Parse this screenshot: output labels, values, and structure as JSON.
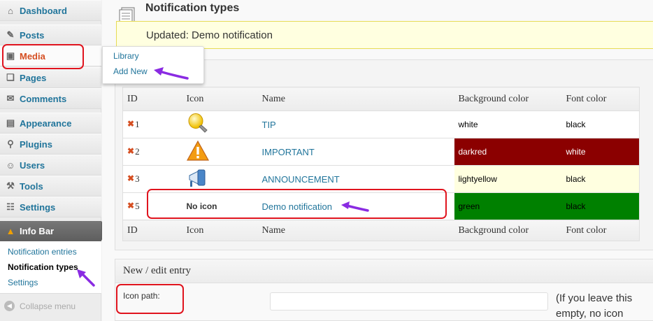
{
  "sidebar": {
    "items": [
      {
        "label": "Dashboard",
        "icon": "dashboard-icon",
        "glyph": "⌂"
      },
      {
        "label": "Posts",
        "icon": "pushpin-icon",
        "glyph": "✎"
      },
      {
        "label": "Media",
        "icon": "media-icon",
        "glyph": "▣"
      },
      {
        "label": "Pages",
        "icon": "pages-icon",
        "glyph": "❏"
      },
      {
        "label": "Comments",
        "icon": "comments-icon",
        "glyph": "✉"
      },
      {
        "label": "Appearance",
        "icon": "appearance-icon",
        "glyph": "▤"
      },
      {
        "label": "Plugins",
        "icon": "plugins-icon",
        "glyph": "⚲"
      },
      {
        "label": "Users",
        "icon": "users-icon",
        "glyph": "☺"
      },
      {
        "label": "Tools",
        "icon": "tools-icon",
        "glyph": "⚒"
      },
      {
        "label": "Settings",
        "icon": "settings-icon",
        "glyph": "☷"
      }
    ],
    "info_bar": {
      "label": "Info Bar",
      "icon": "warning-icon",
      "glyph": "▲"
    },
    "submenu": [
      "Notification entries",
      "Notification types",
      "Settings"
    ],
    "collapse_label": "Collapse menu"
  },
  "flyout": {
    "items": [
      "Library",
      "Add New"
    ]
  },
  "main": {
    "title": "Notification types",
    "notice": "Updated: Demo notification",
    "table": {
      "columns": [
        "ID",
        "Icon",
        "Name",
        "Background color",
        "Font color"
      ],
      "rows": [
        {
          "id": "1",
          "icon": "lightbulb-icon",
          "name": "TIP",
          "bg": "white",
          "font": "black",
          "bg_hex": "#ffffff",
          "fg_hex": "#000000"
        },
        {
          "id": "2",
          "icon": "warning-icon",
          "name": "IMPORTANT",
          "bg": "darkred",
          "font": "white",
          "bg_hex": "#8b0000",
          "fg_hex": "#ffffff"
        },
        {
          "id": "3",
          "icon": "megaphone-icon",
          "name": "ANNOUNCEMENT",
          "bg": "lightyellow",
          "font": "black",
          "bg_hex": "#ffffe0",
          "fg_hex": "#000000"
        },
        {
          "id": "5",
          "icon": "",
          "icon_text": "No icon",
          "name": "Demo notification",
          "bg": "green",
          "font": "black",
          "bg_hex": "#008000",
          "fg_hex": "#000000"
        }
      ]
    },
    "edit": {
      "heading": "New / edit entry",
      "icon_path_label": "Icon path:",
      "icon_path_value": "",
      "help_text": "(If you leave this empty, no icon"
    }
  },
  "colors": {
    "link": "#21759b",
    "active": "#d54e21",
    "annotation_red": "#e0141e",
    "annotation_arrow": "#8a2be2"
  }
}
